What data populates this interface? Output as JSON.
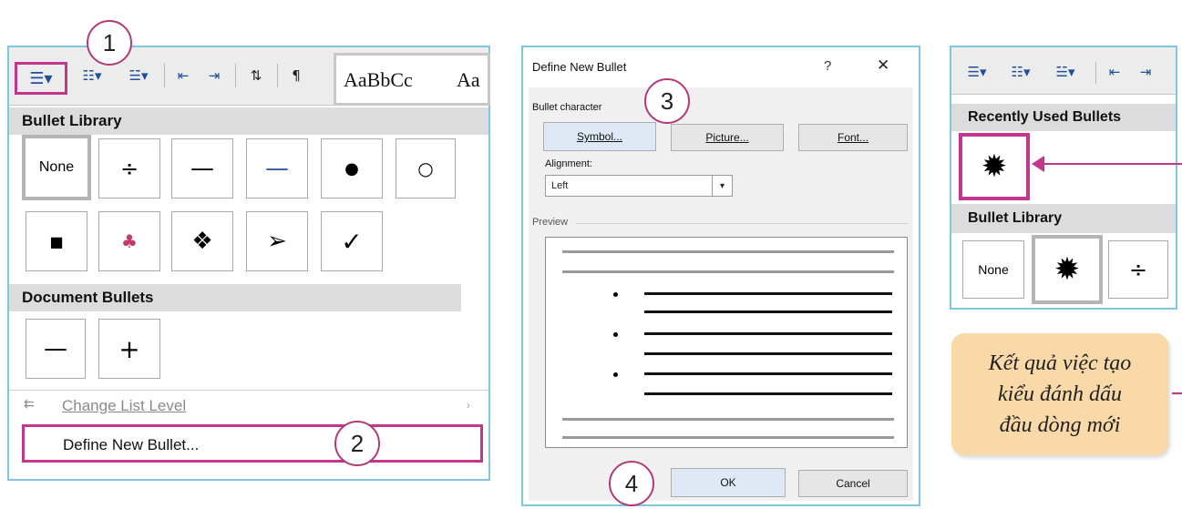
{
  "left_panel": {
    "style_preview_1": "AaBbCc",
    "style_preview_2": "Aa",
    "bullet_library_title": "Bullet Library",
    "bullet_none_label": "None",
    "bullet_library_glyphs": [
      "÷",
      "—",
      "—",
      "●",
      "○",
      "■",
      "♣",
      "❖",
      "➢",
      "✓"
    ],
    "document_bullets_title": "Document Bullets",
    "document_bullet_glyphs": [
      "—",
      "+"
    ],
    "change_list_level_label": "Change List Level",
    "define_new_bullet_label": "Define New Bullet..."
  },
  "dialog": {
    "title": "Define New Bullet",
    "help_glyph": "?",
    "close_glyph": "✕",
    "bullet_character_label": "Bullet character",
    "symbol_button": "Symbol...",
    "picture_button": "Picture...",
    "font_button": "Font...",
    "alignment_label": "Alignment:",
    "alignment_value": "Left",
    "preview_label": "Preview",
    "ok_button": "OK",
    "cancel_button": "Cancel"
  },
  "right_panel": {
    "recently_used_title": "Recently Used Bullets",
    "recent_bullet_glyph": "✹",
    "bullet_library_title": "Bullet Library",
    "none_label": "None",
    "library_glyphs": [
      "✹",
      "÷"
    ]
  },
  "callout": {
    "line1": "Kết quả việc tạo",
    "line2": "kiểu đánh dấu",
    "line3": "đầu dòng mới"
  },
  "badges": [
    "1",
    "2",
    "3",
    "4"
  ],
  "colors": {
    "highlight": "#c2368d",
    "frame": "#7fc6e0",
    "callout_bg": "#f9d9a8"
  }
}
